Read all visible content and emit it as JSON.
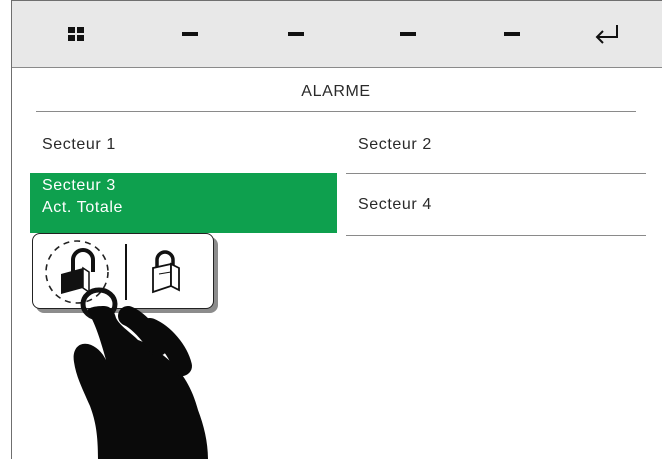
{
  "toolbar": {
    "buttons": [
      {
        "name": "grid-menu-icon"
      },
      {
        "name": "dash-icon"
      },
      {
        "name": "dash-icon"
      },
      {
        "name": "dash-icon"
      },
      {
        "name": "dash-icon"
      },
      {
        "name": "return-arrow-icon"
      }
    ]
  },
  "page": {
    "title": "ALARME"
  },
  "sectors": {
    "s1": {
      "label": "Secteur 1"
    },
    "s2": {
      "label": "Secteur 2"
    },
    "s3": {
      "label": "Secteur 3",
      "status": "Act. Totale",
      "active_color": "#0ea04e"
    },
    "s4": {
      "label": "Secteur 4"
    }
  },
  "popup": {
    "options": [
      "unlock-icon",
      "lock-icon"
    ]
  },
  "overlay": {
    "icon": "pointing-hand-icon"
  }
}
